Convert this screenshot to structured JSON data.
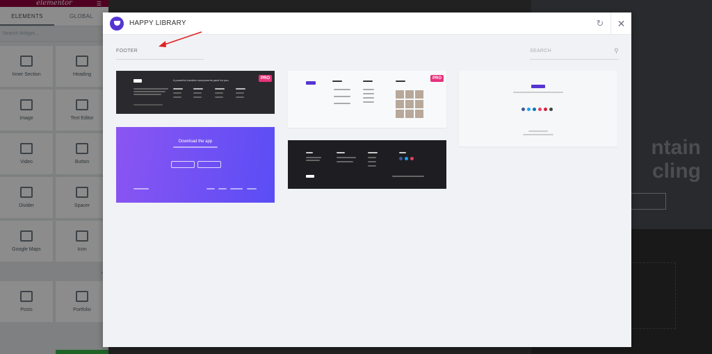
{
  "editor": {
    "logo": "elementor",
    "tabs": [
      "ELEMENTS",
      "GLOBAL"
    ],
    "search_placeholder": "Search Widget...",
    "widgets": [
      "Inner Section",
      "Heading",
      "Image",
      "Text Editor",
      "Video",
      "Button",
      "Divider",
      "Spacer",
      "Google Maps",
      "Icon",
      "Posts",
      "Portfolio"
    ],
    "hero_lines": [
      "ntain",
      "cling"
    ]
  },
  "modal": {
    "title": "HAPPY LIBRARY",
    "filter_label": "FOOTER",
    "search_placeholder": "SEARCH",
    "cards": [
      {
        "badge": "PRO",
        "tagline": "A powerful creative components pack for you"
      },
      {
        "heading": "Download the app"
      },
      {
        "badge": "PRO"
      },
      {},
      {}
    ]
  },
  "colors": {
    "accent": "#5636d1",
    "pro_badge": "#e6337b",
    "annotation_arrow": "#e02020"
  }
}
